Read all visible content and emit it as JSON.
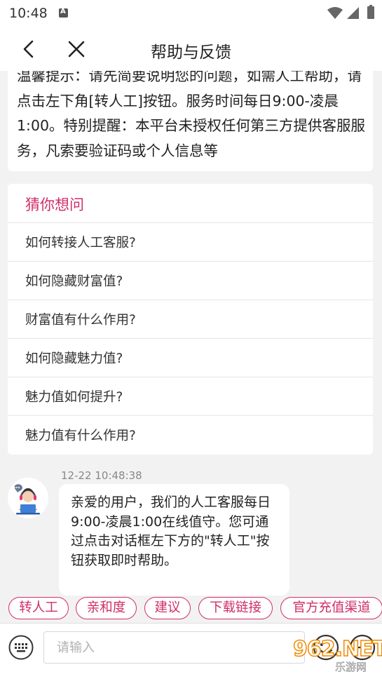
{
  "status_bar": {
    "time": "10:48",
    "notification_icon": "a-icon",
    "icons": [
      "wifi-icon",
      "signal-icon",
      "battery-icon"
    ]
  },
  "nav": {
    "title": "帮助与反馈",
    "back_icon": "back-chevron-icon",
    "close_icon": "close-icon"
  },
  "notice": {
    "text": "温馨提示：请先简要说明您的问题，如需人工帮助，请点击左下角[转人工]按钮。服务时间每日9:00-凌晨1:00。特别提醒：本平台未授权任何第三方提供客服服务，凡索要验证码或个人信息等"
  },
  "faq": {
    "title": "猜你想问",
    "items": [
      "如何转接人工客服?",
      "如何隐藏财富值?",
      "财富值有什么作用?",
      "如何隐藏魅力值?",
      "魅力值如何提升?",
      "魅力值有什么作用?"
    ]
  },
  "chat": {
    "timestamp": "12-22 10:48:38",
    "message": "亲爱的用户，我们的人工客服每日9:00-凌晨1:00在线值守。您可通过点击对话框左下方的\"转人工\"按钮获取即时帮助。"
  },
  "quick_actions": [
    "转人工",
    "亲和度",
    "建议",
    "下载链接",
    "官方充值渠道"
  ],
  "input": {
    "placeholder": "请输入"
  },
  "watermark": {
    "text": "962.NET",
    "subtext": "乐游网"
  },
  "colors": {
    "accent": "#d02e69",
    "background": "#f2f2f2",
    "card": "#ffffff"
  }
}
